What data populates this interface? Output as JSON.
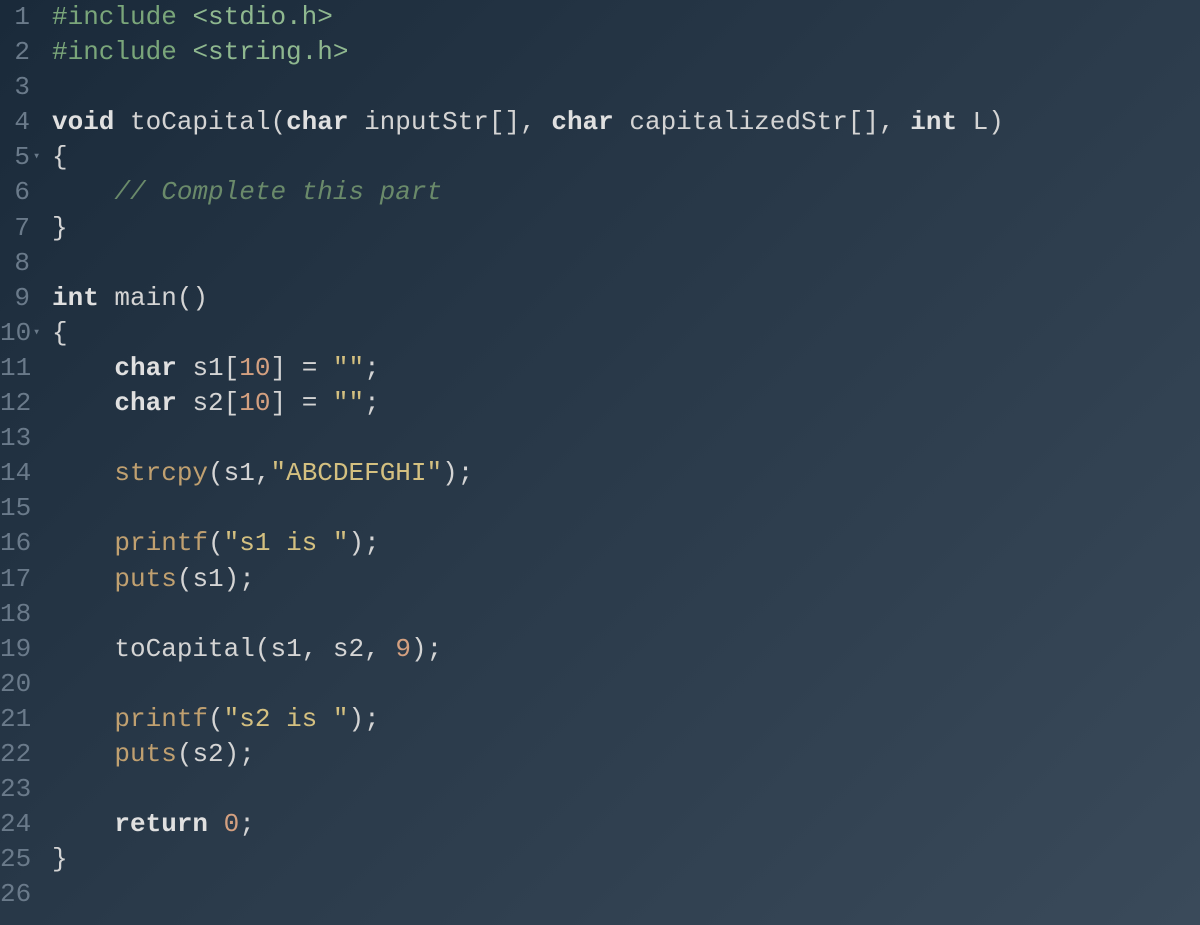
{
  "editor": {
    "lines": [
      {
        "num": 1,
        "fold": false,
        "tokens": [
          {
            "cls": "preproc",
            "t": "#include "
          },
          {
            "cls": "string-inc",
            "t": "<stdio.h>"
          }
        ]
      },
      {
        "num": 2,
        "fold": false,
        "tokens": [
          {
            "cls": "preproc",
            "t": "#include "
          },
          {
            "cls": "string-inc",
            "t": "<string.h>"
          }
        ]
      },
      {
        "num": 3,
        "fold": false,
        "tokens": []
      },
      {
        "num": 4,
        "fold": false,
        "tokens": [
          {
            "cls": "type",
            "t": "void "
          },
          {
            "cls": "func",
            "t": "toCapital"
          },
          {
            "cls": "paren",
            "t": "("
          },
          {
            "cls": "type",
            "t": "char "
          },
          {
            "cls": "ident",
            "t": "inputStr"
          },
          {
            "cls": "paren",
            "t": "[]"
          },
          {
            "cls": "oper",
            "t": ", "
          },
          {
            "cls": "type",
            "t": "char "
          },
          {
            "cls": "ident",
            "t": "capitalizedStr"
          },
          {
            "cls": "paren",
            "t": "[]"
          },
          {
            "cls": "oper",
            "t": ", "
          },
          {
            "cls": "type",
            "t": "int "
          },
          {
            "cls": "ident",
            "t": "L"
          },
          {
            "cls": "paren",
            "t": ")"
          }
        ]
      },
      {
        "num": 5,
        "fold": true,
        "tokens": [
          {
            "cls": "brace",
            "t": "{"
          }
        ]
      },
      {
        "num": 6,
        "fold": false,
        "tokens": [
          {
            "cls": "",
            "t": "    "
          },
          {
            "cls": "comment",
            "t": "// Complete this part"
          }
        ]
      },
      {
        "num": 7,
        "fold": false,
        "tokens": [
          {
            "cls": "brace",
            "t": "}"
          }
        ]
      },
      {
        "num": 8,
        "fold": false,
        "tokens": []
      },
      {
        "num": 9,
        "fold": false,
        "tokens": [
          {
            "cls": "type",
            "t": "int "
          },
          {
            "cls": "func",
            "t": "main"
          },
          {
            "cls": "paren",
            "t": "()"
          }
        ]
      },
      {
        "num": 10,
        "fold": true,
        "tokens": [
          {
            "cls": "brace",
            "t": "{"
          }
        ]
      },
      {
        "num": 11,
        "fold": false,
        "tokens": [
          {
            "cls": "",
            "t": "    "
          },
          {
            "cls": "type",
            "t": "char "
          },
          {
            "cls": "ident",
            "t": "s1"
          },
          {
            "cls": "paren",
            "t": "["
          },
          {
            "cls": "number",
            "t": "10"
          },
          {
            "cls": "paren",
            "t": "]"
          },
          {
            "cls": "oper",
            "t": " = "
          },
          {
            "cls": "string",
            "t": "\"\""
          },
          {
            "cls": "oper",
            "t": ";"
          }
        ]
      },
      {
        "num": 12,
        "fold": false,
        "tokens": [
          {
            "cls": "",
            "t": "    "
          },
          {
            "cls": "type",
            "t": "char "
          },
          {
            "cls": "ident",
            "t": "s2"
          },
          {
            "cls": "paren",
            "t": "["
          },
          {
            "cls": "number",
            "t": "10"
          },
          {
            "cls": "paren",
            "t": "]"
          },
          {
            "cls": "oper",
            "t": " = "
          },
          {
            "cls": "string",
            "t": "\"\""
          },
          {
            "cls": "oper",
            "t": ";"
          }
        ]
      },
      {
        "num": 13,
        "fold": false,
        "tokens": []
      },
      {
        "num": 14,
        "fold": false,
        "tokens": [
          {
            "cls": "",
            "t": "    "
          },
          {
            "cls": "func-call",
            "t": "strcpy"
          },
          {
            "cls": "paren",
            "t": "("
          },
          {
            "cls": "ident",
            "t": "s1"
          },
          {
            "cls": "oper",
            "t": ","
          },
          {
            "cls": "string",
            "t": "\"ABCDEFGHI\""
          },
          {
            "cls": "paren",
            "t": ")"
          },
          {
            "cls": "oper",
            "t": ";"
          }
        ]
      },
      {
        "num": 15,
        "fold": false,
        "tokens": []
      },
      {
        "num": 16,
        "fold": false,
        "tokens": [
          {
            "cls": "",
            "t": "    "
          },
          {
            "cls": "func-call",
            "t": "printf"
          },
          {
            "cls": "paren",
            "t": "("
          },
          {
            "cls": "string",
            "t": "\"s1 is \""
          },
          {
            "cls": "paren",
            "t": ")"
          },
          {
            "cls": "oper",
            "t": ";"
          }
        ]
      },
      {
        "num": 17,
        "fold": false,
        "tokens": [
          {
            "cls": "",
            "t": "    "
          },
          {
            "cls": "func-call",
            "t": "puts"
          },
          {
            "cls": "paren",
            "t": "("
          },
          {
            "cls": "ident",
            "t": "s1"
          },
          {
            "cls": "paren",
            "t": ")"
          },
          {
            "cls": "oper",
            "t": ";"
          }
        ]
      },
      {
        "num": 18,
        "fold": false,
        "tokens": []
      },
      {
        "num": 19,
        "fold": false,
        "tokens": [
          {
            "cls": "",
            "t": "    "
          },
          {
            "cls": "func",
            "t": "toCapital"
          },
          {
            "cls": "paren",
            "t": "("
          },
          {
            "cls": "ident",
            "t": "s1"
          },
          {
            "cls": "oper",
            "t": ", "
          },
          {
            "cls": "ident",
            "t": "s2"
          },
          {
            "cls": "oper",
            "t": ", "
          },
          {
            "cls": "number",
            "t": "9"
          },
          {
            "cls": "paren",
            "t": ")"
          },
          {
            "cls": "oper",
            "t": ";"
          }
        ]
      },
      {
        "num": 20,
        "fold": false,
        "tokens": []
      },
      {
        "num": 21,
        "fold": false,
        "tokens": [
          {
            "cls": "",
            "t": "    "
          },
          {
            "cls": "func-call",
            "t": "printf"
          },
          {
            "cls": "paren",
            "t": "("
          },
          {
            "cls": "string",
            "t": "\"s2 is \""
          },
          {
            "cls": "paren",
            "t": ")"
          },
          {
            "cls": "oper",
            "t": ";"
          }
        ]
      },
      {
        "num": 22,
        "fold": false,
        "tokens": [
          {
            "cls": "",
            "t": "    "
          },
          {
            "cls": "func-call",
            "t": "puts"
          },
          {
            "cls": "paren",
            "t": "("
          },
          {
            "cls": "ident",
            "t": "s2"
          },
          {
            "cls": "paren",
            "t": ")"
          },
          {
            "cls": "oper",
            "t": ";"
          }
        ]
      },
      {
        "num": 23,
        "fold": false,
        "tokens": []
      },
      {
        "num": 24,
        "fold": false,
        "tokens": [
          {
            "cls": "",
            "t": "    "
          },
          {
            "cls": "keyword",
            "t": "return "
          },
          {
            "cls": "number",
            "t": "0"
          },
          {
            "cls": "oper",
            "t": ";"
          }
        ]
      },
      {
        "num": 25,
        "fold": false,
        "tokens": [
          {
            "cls": "brace",
            "t": "}"
          }
        ]
      },
      {
        "num": 26,
        "fold": false,
        "tokens": []
      }
    ]
  }
}
